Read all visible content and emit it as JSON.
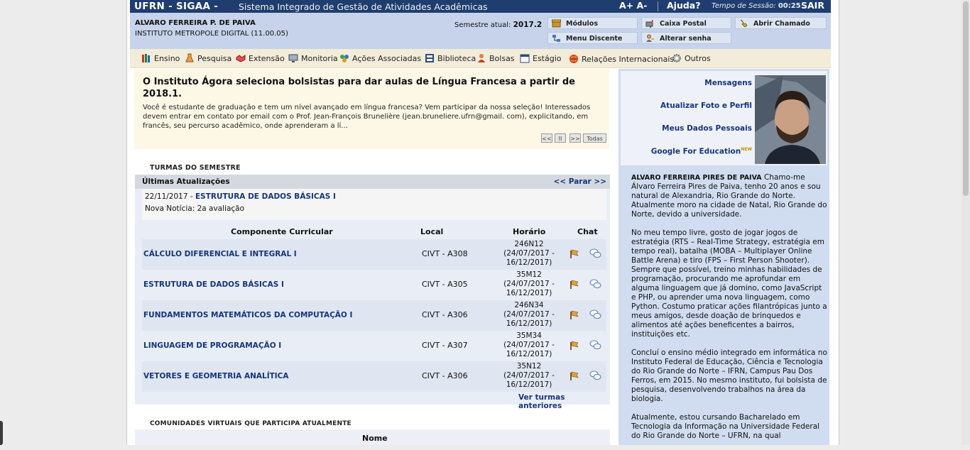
{
  "header": {
    "brand": "UFRN - SIGAA -",
    "system_name": "Sistema Integrado de Gestão de Atividades Acadêmicas",
    "font_increase": "A+",
    "font_decrease": "A-",
    "help": "Ajuda?",
    "session_label": "Tempo de Sessão:",
    "session_time": "00:25",
    "logout": "SAIR"
  },
  "user": {
    "name": "ALVARO FERREIRA P. DE PAIVA",
    "institute": "INSTITUTO METROPOLE DIGITAL (11.00.05)",
    "semester_label": "Semestre atual:",
    "semester": "2017.2"
  },
  "quick_links": [
    "Módulos",
    "Caixa Postal",
    "Abrir Chamado",
    "Menu Discente",
    "Alterar senha"
  ],
  "menu": [
    "Ensino",
    "Pesquisa",
    "Extensão",
    "Monitoria",
    "Ações Associadas",
    "Biblioteca",
    "Bolsas",
    "Estágio",
    "Relações Internacionais",
    "Outros"
  ],
  "news": {
    "title": "O Instituto Ágora seleciona bolsistas para dar aulas de Língua Francesa a partir de 2018.1.",
    "body": "Você é estudante de graduação e tem um nível avançado em língua francesa? Vem participar da nossa seleção! Interessados devem entrar em contato por email com o Prof. Jean-François Brunelière  (jean.bruneliere.ufrn@gmail. com), explicitando, em francês, seu percurso acadêmico, onde aprenderam a lí...",
    "controls": [
      "<<",
      "II",
      ">>",
      "Todas"
    ]
  },
  "turmas": {
    "section_title": "Turmas do Semestre",
    "updates_title": "Últimas Atualizações",
    "pause_link": "<< Parar >>",
    "update_date": "22/11/2017 -",
    "update_course": "ESTRUTURA DE DADOS BÁSICAS I",
    "update_text": "Nova Notícia: 2a avaliação",
    "columns": [
      "Componente Curricular",
      "Local",
      "Horário",
      "Chat"
    ],
    "rows": [
      {
        "component": "CÁLCULO DIFERENCIAL E INTEGRAL I",
        "local": "CIVT - A308",
        "code": "246N12",
        "period": "(24/07/2017 -",
        "end": "16/12/2017)"
      },
      {
        "component": "ESTRUTURA DE DADOS BÁSICAS I",
        "local": "CIVT - A305",
        "code": "35M12",
        "period": "(24/07/2017 -",
        "end": "16/12/2017)"
      },
      {
        "component": "FUNDAMENTOS MATEMÁTICOS DA COMPUTAÇÃO I",
        "local": "CIVT - A306",
        "code": "246N34",
        "period": "(24/07/2017 -",
        "end": "16/12/2017)"
      },
      {
        "component": "LINGUAGEM DE PROGRAMAÇÃO I",
        "local": "CIVT - A307",
        "code": "35M34",
        "period": "(24/07/2017 -",
        "end": "16/12/2017)"
      },
      {
        "component": "VETORES E GEOMETRIA ANALÍTICA",
        "local": "CIVT - A306",
        "code": "35N12",
        "period": "(24/07/2017 -",
        "end": "16/12/2017)"
      }
    ],
    "more_link": "Ver turmas anteriores"
  },
  "comunidades": {
    "section_title": "Comunidades Virtuais que participa atualmente",
    "column_name": "Nome"
  },
  "profile": {
    "links": [
      "Mensagens",
      "Atualizar Foto e Perfil",
      "Meus Dados Pessoais",
      "Google For Education"
    ],
    "new_badge": "NEW",
    "bio_name": "ALVARO FERREIRA PIRES DE PAIVA",
    "bio_p1": "Chamo-me Álvaro Ferreira Pires de Paiva, tenho 20 anos e sou natural de Alexandria, Rio Grande do Norte. Atualmente moro na cidade de Natal, Rio Grande do Norte, devido a universidade.",
    "bio_p2": "No meu tempo livre, gosto de jogar jogos de estratégia (RTS – Real-Time Strategy, estratégia em tempo real), batalha (MOBA – Multiplayer Online Battle Arena) e tiro (FPS – First Person Shooter). Sempre que possível, treino minhas habilidades de programação, procurando me aprofundar em alguma linguagem que já domino, como JavaScript e PHP, ou aprender uma nova linguagem, como Python. Costumo praticar ações filantrópicas junto a meus amigos, desde doação de brinquedos e alimentos até ações beneficentes a bairros, instituições etc.",
    "bio_p3": "Concluí o ensino médio integrado em informática no Instituto Federal de Educação, Ciência e Tecnologia do Rio Grande do Norte – IFRN, Campus Pau Dos Ferros, em 2015. No mesmo instituto, fui bolsista de pesquisa, desenvolvendo trabalhos na área da biologia.",
    "bio_p4": "Atualmente, estou cursando Bacharelado em Tecnologia da Informação na Universidade Federal do Rio Grande do Norte – UFRN, na qual"
  },
  "colors": {
    "header_bg": "#1f3d6e",
    "user_bar_bg": "#c6d3ea",
    "menu_bg": "#f3ecd9",
    "link": "#16357a",
    "news_bg": "#fdf8e6",
    "sidebar_bg": "#d0dcef"
  },
  "icons": {
    "modulos": "package-icon",
    "caixa_postal": "mailbox-icon",
    "abrir_chamado": "phone-icon",
    "menu_discente": "network-icon",
    "alterar_senha": "user-key-icon",
    "forum": "forum-icon",
    "chat": "chat-bubble-icon"
  }
}
